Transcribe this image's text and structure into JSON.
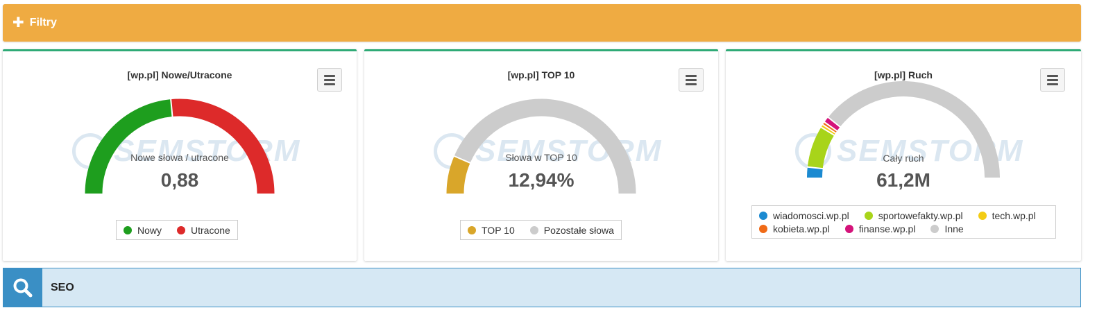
{
  "filters": {
    "label": "Filtry",
    "icon": "plus-icon"
  },
  "widgets": [
    {
      "title": "[wp.pl] Nowe/Utracone",
      "center_label": "Nowe słowa / utracone",
      "center_value": "0,88",
      "legend": [
        {
          "label": "Nowy",
          "color": "#1e9e1e"
        },
        {
          "label": "Utracone",
          "color": "#dd2a2a"
        }
      ]
    },
    {
      "title": "[wp.pl] TOP 10",
      "center_label": "Słowa w TOP 10",
      "center_value": "12,94%",
      "legend": [
        {
          "label": "TOP 10",
          "color": "#d9a62a"
        },
        {
          "label": "Pozostałe słowa",
          "color": "#cccccc"
        }
      ]
    },
    {
      "title": "[wp.pl] Ruch",
      "center_label": "Cały ruch",
      "center_value": "61,2M",
      "legend": [
        {
          "label": "wiadomosci.wp.pl",
          "color": "#1b8ad1"
        },
        {
          "label": "sportowefakty.wp.pl",
          "color": "#a8d41a"
        },
        {
          "label": "tech.wp.pl",
          "color": "#f3cc14"
        },
        {
          "label": "kobieta.wp.pl",
          "color": "#f06a17"
        },
        {
          "label": "finanse.wp.pl",
          "color": "#d4137a"
        },
        {
          "label": "Inne",
          "color": "#cccccc"
        }
      ]
    }
  ],
  "chart_data": [
    {
      "type": "pie",
      "variant": "semi-donut",
      "title": "[wp.pl] Nowe/Utracone",
      "series": [
        {
          "name": "Nowy",
          "value": 0.47,
          "color": "#1e9e1e"
        },
        {
          "name": "Utracone",
          "value": 0.53,
          "color": "#dd2a2a"
        }
      ]
    },
    {
      "type": "pie",
      "variant": "semi-donut",
      "title": "[wp.pl] TOP 10",
      "series": [
        {
          "name": "TOP 10",
          "value": 12.94,
          "color": "#d9a62a"
        },
        {
          "name": "Pozostałe słowa",
          "value": 87.06,
          "color": "#cccccc"
        }
      ]
    },
    {
      "type": "pie",
      "variant": "semi-donut",
      "title": "[wp.pl] Ruch",
      "series": [
        {
          "name": "wiadomosci.wp.pl",
          "value": 3.5,
          "color": "#1b8ad1"
        },
        {
          "name": "sportowefakty.wp.pl",
          "value": 14,
          "color": "#a8d41a"
        },
        {
          "name": "tech.wp.pl",
          "value": 1,
          "color": "#f3cc14"
        },
        {
          "name": "kobieta.wp.pl",
          "value": 1,
          "color": "#f06a17"
        },
        {
          "name": "finanse.wp.pl",
          "value": 2,
          "color": "#d4137a"
        },
        {
          "name": "Inne",
          "value": 78.5,
          "color": "#cccccc"
        }
      ]
    }
  ],
  "watermark": "SEMSTORM",
  "search": {
    "query": "SEO",
    "icon": "search-icon"
  }
}
